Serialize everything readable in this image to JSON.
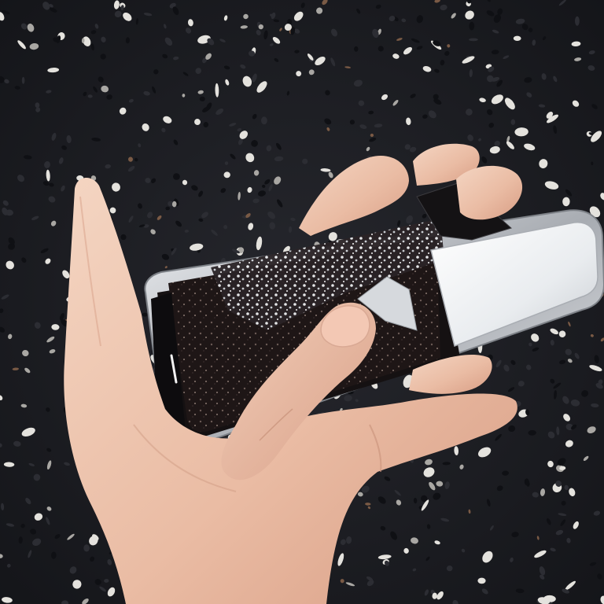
{
  "scene": {
    "subject": "hand-holding-broken-phone",
    "colors": {
      "gravel_base": "#1c1d22",
      "gravel_dark": "#0f1014",
      "pebble_light": "#e4e2dd",
      "pebble_mid": "#a9a7a3",
      "pebble_warm": "#7a5a45",
      "skin_light": "#f3d3c0",
      "skin_mid": "#e7b8a0",
      "skin_shadow": "#c98f76",
      "phone_frame": "#c9ccd1",
      "phone_frame_dark": "#6d7076",
      "screen_dark": "#1a1414",
      "glass_white": "#f4f6f8"
    }
  }
}
